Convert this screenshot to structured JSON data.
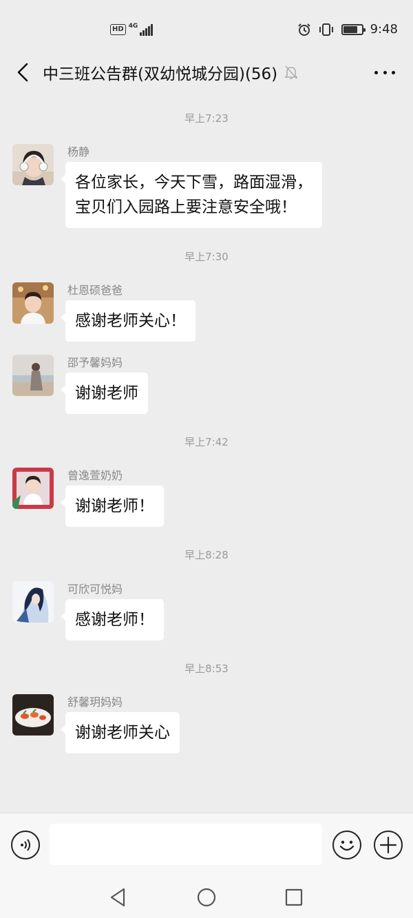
{
  "status_bar": {
    "hd": "HD",
    "network": "4G",
    "time": "9:48",
    "battery_level": 0.8,
    "icons": [
      "alarm-icon",
      "vibrate-icon",
      "battery-icon"
    ]
  },
  "nav": {
    "title": "中三班公告群(双幼悦城分园)(56)",
    "icons": [
      "back-arrow-icon",
      "mute-bell-icon",
      "more-dots-icon"
    ]
  },
  "timestamps": [
    "早上7:23",
    "早上7:30",
    "早上7:42",
    "早上8:28",
    "早上8:53"
  ],
  "messages": [
    {
      "sender": "杨静",
      "lines": [
        "各位家长，今天下雪，路面湿滑，",
        "宝贝们入园路上要注意安全哦！"
      ],
      "avatar": "avatar-girl-headphones"
    },
    {
      "sender": "杜恩硕爸爸",
      "lines": [
        "感谢老师关心！"
      ],
      "avatar": "avatar-boy"
    },
    {
      "sender": "邵予馨妈妈",
      "lines": [
        "谢谢老师"
      ],
      "avatar": "avatar-beach"
    },
    {
      "sender": "曾逸萱奶奶",
      "lines": [
        "谢谢老师！"
      ],
      "avatar": "avatar-girl-red"
    },
    {
      "sender": "可欣可悦妈",
      "lines": [
        "感谢老师！"
      ],
      "avatar": "avatar-anime"
    },
    {
      "sender": "舒馨玥妈妈",
      "lines": [
        "谢谢老师关心"
      ],
      "avatar": "avatar-food"
    }
  ],
  "input_bar": {
    "placeholder": "",
    "icons": [
      "voice-icon",
      "emoji-icon",
      "plus-icon"
    ]
  },
  "system_nav": {
    "icons": [
      "back-triangle-icon",
      "home-circle-icon",
      "recents-square-icon"
    ]
  }
}
